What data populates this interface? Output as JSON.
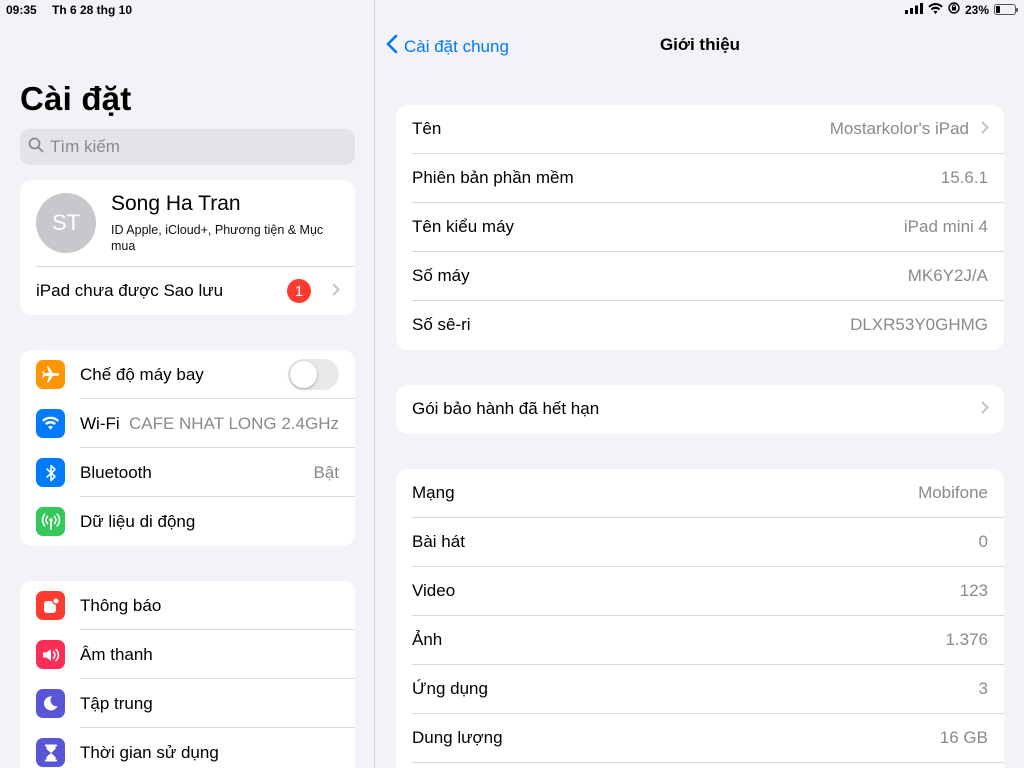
{
  "status_bar": {
    "time": "09:35",
    "date": "Th 6 28 thg 10",
    "battery_percent": "23%",
    "battery_level": 0.23
  },
  "sidebar": {
    "title": "Cài đặt",
    "search_placeholder": "Tìm kiếm",
    "profile": {
      "initials": "ST",
      "name": "Song Ha Tran",
      "subtitle": "ID Apple, iCloud+, Phương tiện & Mục mua",
      "backup_label": "iPad chưa được Sao lưu",
      "badge_count": "1"
    },
    "connectivity": [
      {
        "label": "Chế độ máy bay",
        "value": "",
        "icon": "airplane-icon",
        "color": "#ff9500"
      },
      {
        "label": "Wi-Fi",
        "value": "CAFE NHAT LONG 2.4GHz",
        "icon": "wifi-icon",
        "color": "#007aff"
      },
      {
        "label": "Bluetooth",
        "value": "Bật",
        "icon": "bluetooth-icon",
        "color": "#007aff"
      },
      {
        "label": "Dữ liệu di động",
        "value": "",
        "icon": "cellular-icon",
        "color": "#34c759"
      }
    ],
    "notifications": [
      {
        "label": "Thông báo",
        "icon": "notification-icon",
        "color": "#ff3b30"
      },
      {
        "label": "Âm thanh",
        "icon": "sound-icon",
        "color": "#ff2d55"
      },
      {
        "label": "Tập trung",
        "icon": "moon-icon",
        "color": "#5856d6"
      },
      {
        "label": "Thời gian sử dụng",
        "icon": "hourglass-icon",
        "color": "#5856d6"
      }
    ]
  },
  "detail": {
    "back_label": "Cài đặt chung",
    "title": "Giới thiệu",
    "group1": [
      {
        "label": "Tên",
        "value": "Mostarkolor's iPad"
      },
      {
        "label": "Phiên bản phần mềm",
        "value": "15.6.1"
      },
      {
        "label": "Tên kiểu máy",
        "value": "iPad mini 4"
      },
      {
        "label": "Số máy",
        "value": "MK6Y2J/A"
      },
      {
        "label": "Số sê-ri",
        "value": "DLXR53Y0GHMG"
      }
    ],
    "group2": [
      {
        "label": "Gói bảo hành đã hết hạn"
      }
    ],
    "group3": [
      {
        "label": "Mạng",
        "value": "Mobifone"
      },
      {
        "label": "Bài hát",
        "value": "0"
      },
      {
        "label": "Video",
        "value": "123"
      },
      {
        "label": "Ảnh",
        "value": "1.376"
      },
      {
        "label": "Ứng dụng",
        "value": "3"
      },
      {
        "label": "Dung lượng",
        "value": "16 GB"
      }
    ]
  }
}
